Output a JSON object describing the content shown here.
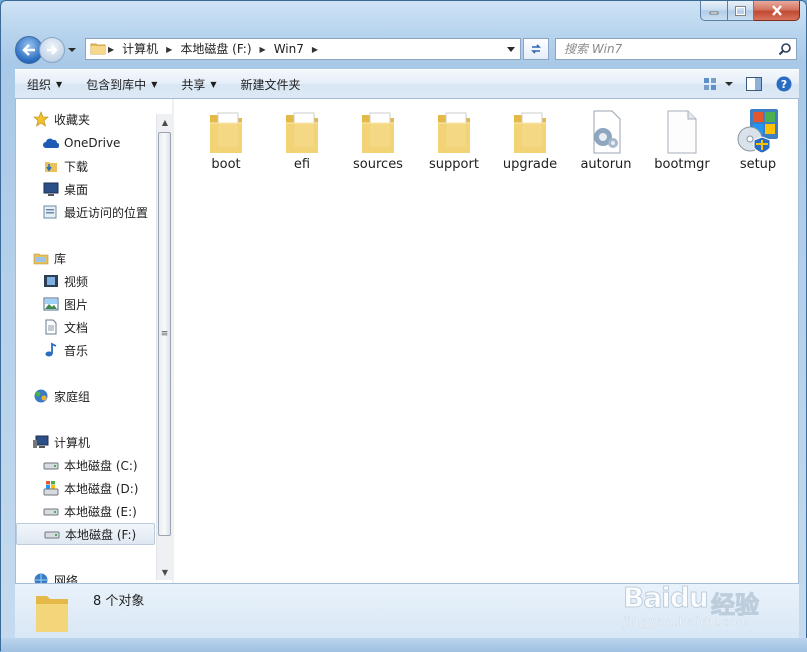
{
  "address": {
    "crumbs": [
      "计算机",
      "本地磁盘 (F:)",
      "Win7"
    ]
  },
  "search": {
    "placeholder": "搜索 Win7"
  },
  "toolbar": {
    "organize": "组织",
    "include_library": "包含到库中",
    "share": "共享",
    "new_folder": "新建文件夹"
  },
  "nav": {
    "favorites": "收藏夹",
    "onedrive": "OneDrive",
    "downloads": "下载",
    "desktop": "桌面",
    "recent": "最近访问的位置",
    "libraries": "库",
    "videos": "视频",
    "pictures": "图片",
    "documents": "文档",
    "music": "音乐",
    "homegroup": "家庭组",
    "computer": "计算机",
    "drive_c": "本地磁盘 (C:)",
    "drive_d": "本地磁盘 (D:)",
    "drive_e": "本地磁盘 (E:)",
    "drive_f": "本地磁盘 (F:)",
    "network": "网络"
  },
  "files": [
    {
      "name": "boot",
      "icon": "folder-icon"
    },
    {
      "name": "efi",
      "icon": "folder-icon"
    },
    {
      "name": "sources",
      "icon": "folder-icon"
    },
    {
      "name": "support",
      "icon": "folder-icon"
    },
    {
      "name": "upgrade",
      "icon": "folder-icon"
    },
    {
      "name": "autorun",
      "icon": "settings-file-icon"
    },
    {
      "name": "bootmgr",
      "icon": "blank-file-icon"
    },
    {
      "name": "setup",
      "icon": "setup-icon"
    }
  ],
  "status": {
    "count_text": "8 个对象"
  },
  "watermark": {
    "brand": "Baidu",
    "cn": "经验",
    "url": "jingyan.baidu.com"
  },
  "colors": {
    "accent": "#2a6cc0",
    "folder": "#f3d57a",
    "close": "#c14a32"
  }
}
